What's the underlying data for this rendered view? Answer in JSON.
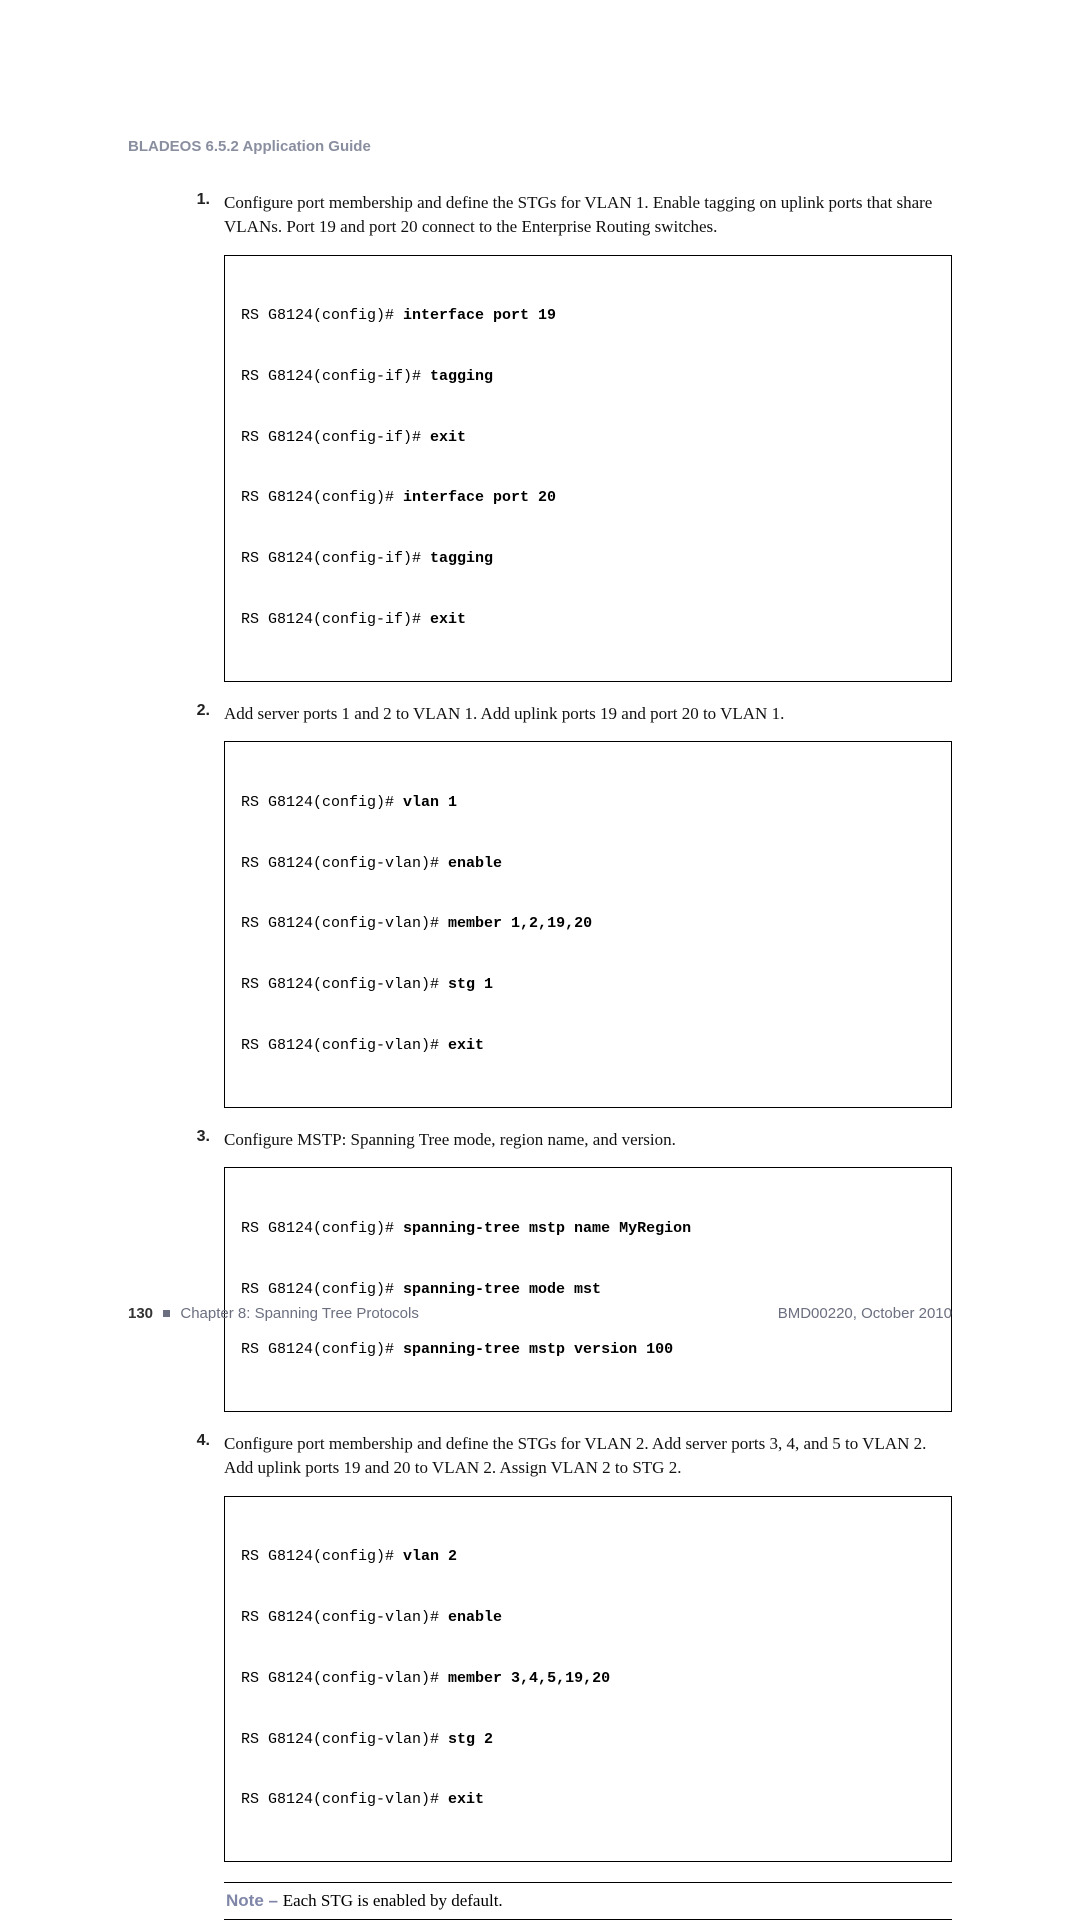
{
  "header": {
    "title": "BLADEOS 6.5.2 Application Guide"
  },
  "steps": [
    {
      "num": "1.",
      "text": "Configure port membership and define the STGs for VLAN 1. Enable tagging on uplink ports that share VLANs. Port 19 and port 20 connect to the Enterprise Routing switches.",
      "code": [
        {
          "prompt": "RS G8124(config)# ",
          "cmd": "interface port 19"
        },
        {
          "prompt": "RS G8124(config-if)# ",
          "cmd": "tagging"
        },
        {
          "prompt": "RS G8124(config-if)# ",
          "cmd": "exit"
        },
        {
          "prompt": "RS G8124(config)# ",
          "cmd": "interface port 20"
        },
        {
          "prompt": "RS G8124(config-if)# ",
          "cmd": "tagging"
        },
        {
          "prompt": "RS G8124(config-if)# ",
          "cmd": "exit"
        }
      ]
    },
    {
      "num": "2.",
      "text": "Add server ports 1 and 2 to VLAN 1. Add uplink ports 19 and port 20 to VLAN 1.",
      "code": [
        {
          "prompt": "RS G8124(config)# ",
          "cmd": "vlan 1"
        },
        {
          "prompt": "RS G8124(config-vlan)# ",
          "cmd": "enable"
        },
        {
          "prompt": "RS G8124(config-vlan)# ",
          "cmd": "member 1,2,19,20"
        },
        {
          "prompt": "RS G8124(config-vlan)# ",
          "cmd": "stg 1"
        },
        {
          "prompt": "RS G8124(config-vlan)# ",
          "cmd": "exit"
        }
      ]
    },
    {
      "num": "3.",
      "text": "Configure MSTP: Spanning Tree mode, region name, and version.",
      "code": [
        {
          "prompt": "RS G8124(config)# ",
          "cmd": "spanning-tree mstp name MyRegion"
        },
        {
          "prompt": "RS G8124(config)# ",
          "cmd": "spanning-tree mode mst"
        },
        {
          "prompt": "RS G8124(config)# ",
          "cmd": "spanning-tree mstp version 100"
        }
      ]
    },
    {
      "num": "4.",
      "text": "Configure port membership and define the STGs for VLAN 2. Add server ports 3, 4, and 5 to VLAN 2. Add uplink ports 19 and 20 to VLAN 2. Assign VLAN 2 to STG 2.",
      "code": [
        {
          "prompt": "RS G8124(config)# ",
          "cmd": "vlan 2"
        },
        {
          "prompt": "RS G8124(config-vlan)# ",
          "cmd": "enable"
        },
        {
          "prompt": "RS G8124(config-vlan)# ",
          "cmd": "member 3,4,5,19,20"
        },
        {
          "prompt": "RS G8124(config-vlan)# ",
          "cmd": "stg 2"
        },
        {
          "prompt": "RS G8124(config-vlan)# ",
          "cmd": "exit"
        }
      ]
    }
  ],
  "note": {
    "label": "Note – ",
    "text": "Each STG is enabled by default."
  },
  "footer": {
    "page": "130",
    "chapter": "Chapter 8: Spanning Tree Protocols",
    "doc": "BMD00220, October 2010"
  }
}
